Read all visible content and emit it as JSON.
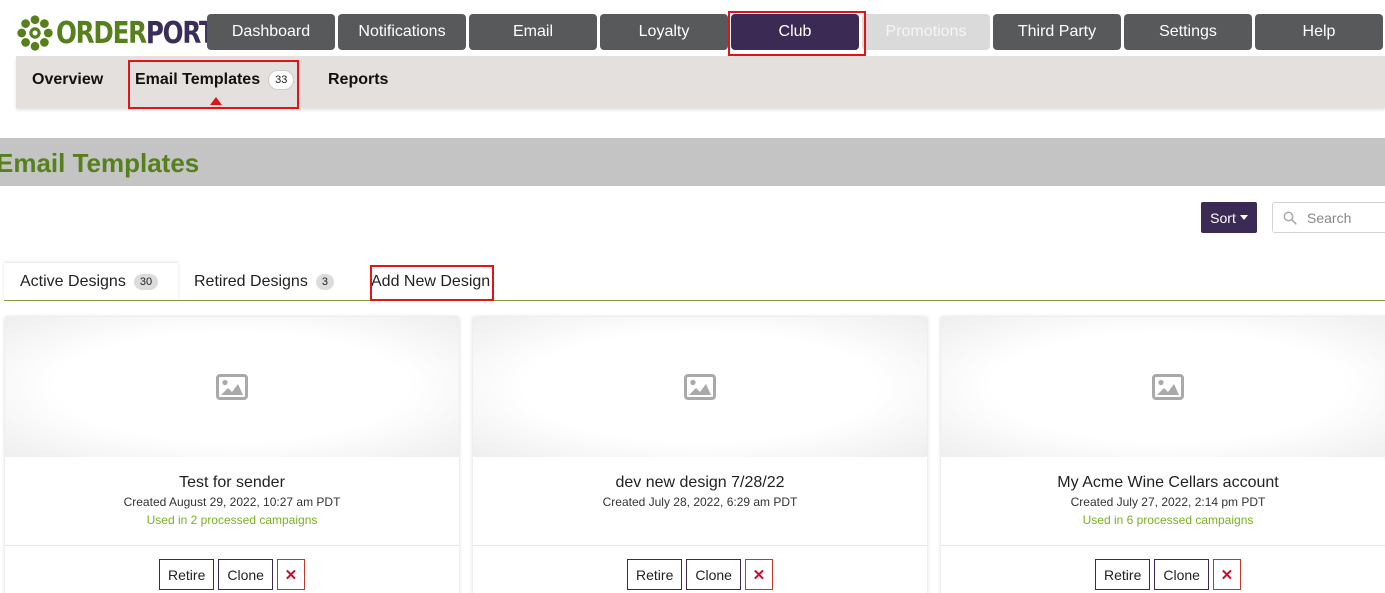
{
  "logo": {
    "text_part1": "ORDER",
    "text_part2": "PORT",
    "icon": "flower-logo-icon",
    "colors": {
      "green": "#56801c",
      "purple": "#3b2d5a"
    }
  },
  "topnav": {
    "items": [
      {
        "label": "Dashboard",
        "state": "normal"
      },
      {
        "label": "Notifications",
        "state": "normal"
      },
      {
        "label": "Email",
        "state": "normal"
      },
      {
        "label": "Loyalty",
        "state": "normal"
      },
      {
        "label": "Club",
        "state": "active"
      },
      {
        "label": "Promotions",
        "state": "disabled"
      },
      {
        "label": "Third Party",
        "state": "normal"
      },
      {
        "label": "Settings",
        "state": "normal"
      },
      {
        "label": "Help",
        "state": "normal"
      }
    ]
  },
  "subnav": {
    "overview": "Overview",
    "email_templates": "Email Templates",
    "email_templates_count": "33",
    "reports": "Reports"
  },
  "page": {
    "title": "Email Templates"
  },
  "toolbar": {
    "sort_label": "Sort",
    "search_placeholder": "Search"
  },
  "tabs": {
    "active_label": "Active Designs",
    "active_count": "30",
    "retired_label": "Retired Designs",
    "retired_count": "3",
    "add_new_label": "Add New Design"
  },
  "cards": [
    {
      "name": "Test for sender",
      "created": "Created August 29, 2022, 10:27 am PDT",
      "used": "Used in 2 processed campaigns",
      "retire": "Retire",
      "clone": "Clone",
      "delete": "✕"
    },
    {
      "name": "dev new design 7/28/22",
      "created": "Created July 28, 2022, 6:29 am PDT",
      "used": "",
      "retire": "Retire",
      "clone": "Clone",
      "delete": "✕"
    },
    {
      "name": "My Acme Wine Cellars account",
      "created": "Created July 27, 2022, 2:14 pm PDT",
      "used": "Used in 6 processed campaigns",
      "retire": "Retire",
      "clone": "Clone",
      "delete": "✕"
    }
  ],
  "colors": {
    "accent_purple": "#3a2a54",
    "accent_green": "#56801c",
    "nav_gray": "#58595b",
    "highlight_red": "#e0141b"
  }
}
